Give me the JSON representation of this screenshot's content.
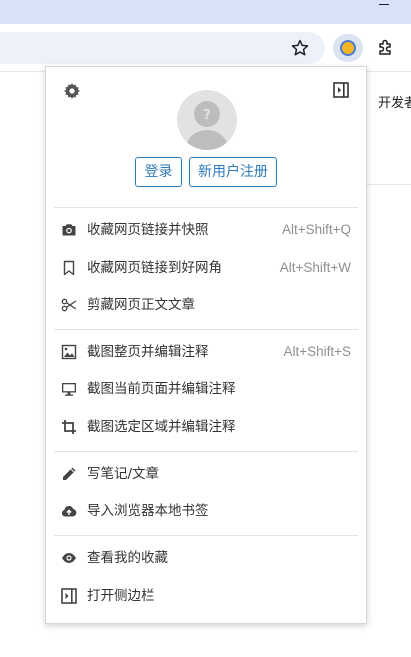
{
  "page": {
    "right_text": "开发者"
  },
  "popup": {
    "auth": {
      "login_label": "登录",
      "register_label": "新用户注册"
    },
    "menu": [
      {
        "icon": "camera-icon",
        "label": "收藏网页链接并快照",
        "shortcut": "Alt+Shift+Q"
      },
      {
        "icon": "bookmark-icon",
        "label": "收藏网页链接到好网角",
        "shortcut": "Alt+Shift+W"
      },
      {
        "icon": "scissors-icon",
        "label": "剪藏网页正文文章",
        "shortcut": ""
      },
      {
        "icon": "image-icon",
        "label": "截图整页并编辑注释",
        "shortcut": "Alt+Shift+S"
      },
      {
        "icon": "monitor-icon",
        "label": "截图当前页面并编辑注释",
        "shortcut": ""
      },
      {
        "icon": "crop-icon",
        "label": "截图选定区域并编辑注释",
        "shortcut": ""
      },
      {
        "icon": "pencil-icon",
        "label": "写笔记/文章",
        "shortcut": ""
      },
      {
        "icon": "cloud-upload-icon",
        "label": "导入浏览器本地书签",
        "shortcut": ""
      },
      {
        "icon": "eye-icon",
        "label": "查看我的收藏",
        "shortcut": ""
      },
      {
        "icon": "sidebar-icon",
        "label": "打开侧边栏",
        "shortcut": ""
      }
    ]
  },
  "colors": {
    "accent": "#2e7ab8",
    "text": "#333333",
    "shortcut": "#8f8f8f",
    "titlebar": "#d8e2f8"
  }
}
